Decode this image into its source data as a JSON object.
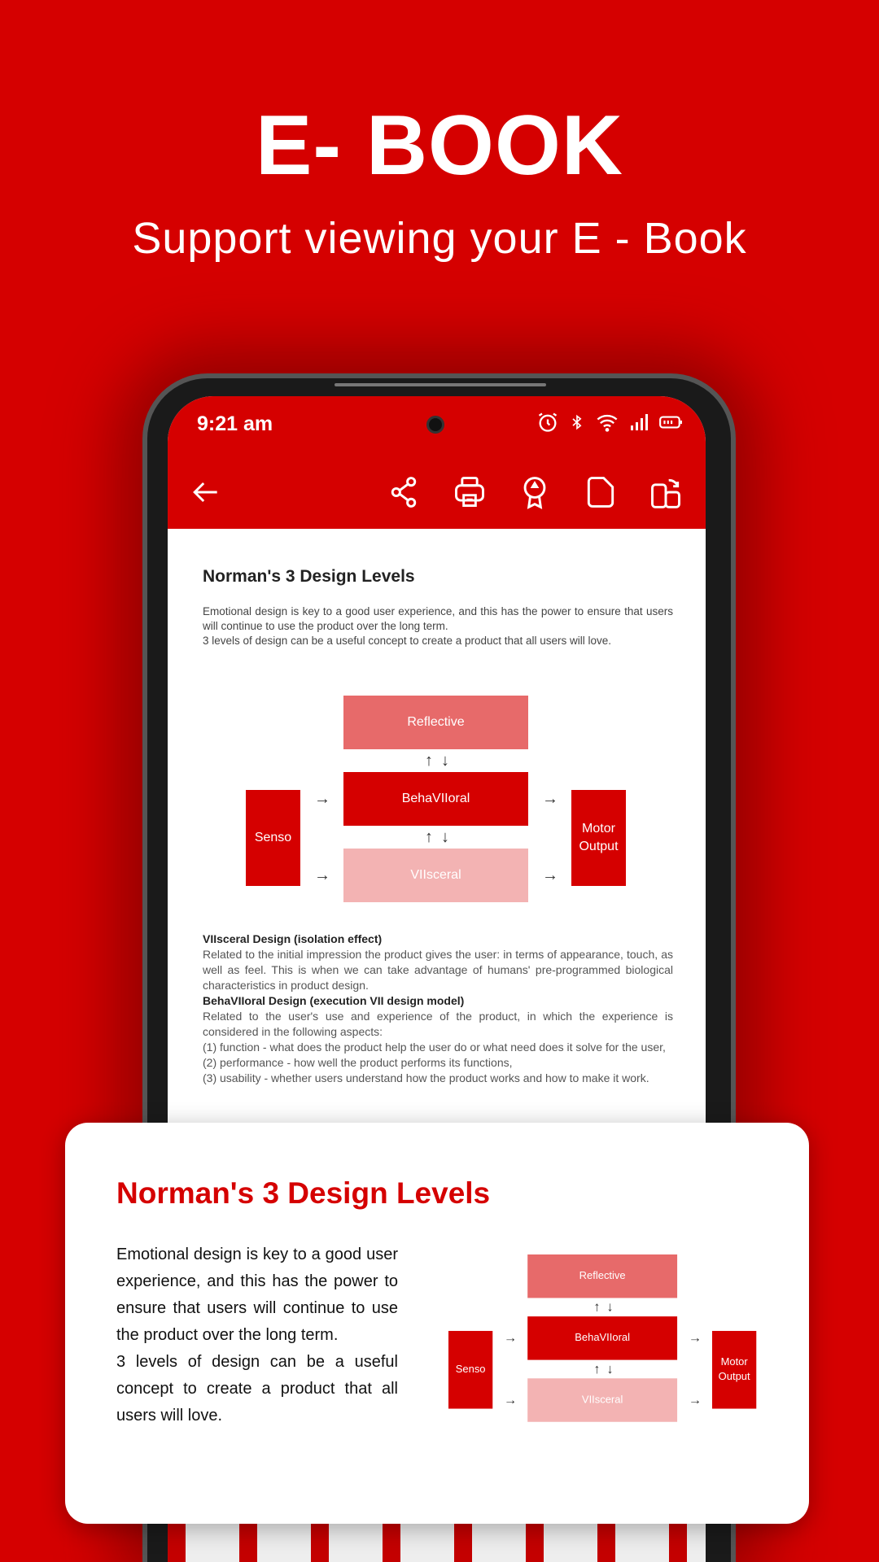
{
  "hero": {
    "title": "E- BOOK",
    "subtitle": "Support viewing your E - Book"
  },
  "status_bar": {
    "time": "9:21 am",
    "icons": [
      "alarm-icon",
      "bluetooth-icon",
      "wifi-icon",
      "signal-icon",
      "battery-icon"
    ]
  },
  "toolbar": {
    "icons": [
      "back-arrow-icon",
      "share-icon",
      "print-icon",
      "award-icon",
      "page-icon",
      "rotate-icon"
    ]
  },
  "document": {
    "title": "Norman's 3 Design Levels",
    "intro1": "Emotional design is key to a good user experience, and this has the power to ensure that users will continue to use the product over the long term.",
    "intro2": "3 levels of design can be a useful concept to create a product that all users will love.",
    "visceral_heading": "VIIsceral Design (isolation effect)",
    "visceral_text": "Related to the initial impression the product gives the user: in terms of appearance, touch, as well as feel. This is when we can take advantage of humans' pre-programmed biological characteristics in product design.",
    "behavioral_heading": "BehaVIIoral Design (execution VII design model)",
    "behavioral_text": "Related to the user's use and experience of the product, in which the experience is considered in the following aspects:",
    "item1": "(1) function - what does the product help the user do or what need does it solve for the user,",
    "item2": "(2) performance - how well the product performs its functions,",
    "item3": "(3) usability - whether users understand how the product works and how to make it work."
  },
  "diagram": {
    "reflective": "Reflective",
    "behavioral": "BehaVIIoral",
    "visceral": "VIIsceral",
    "senso": "Senso",
    "motor": "Motor Output",
    "arrow_right": "→",
    "arrow_up": "↑",
    "arrow_down": "↓"
  },
  "card": {
    "title": "Norman's 3 Design Levels",
    "p1": "Emotional design is key to a good user experience, and this has the power to ensure that users will continue to use the product over the long term.",
    "p2": "3 levels of design can be a useful concept to create a product that all users will love."
  },
  "colors": {
    "brand": "#d50000",
    "reflective": "#e76a6a",
    "visceral": "#f3b3b3"
  }
}
